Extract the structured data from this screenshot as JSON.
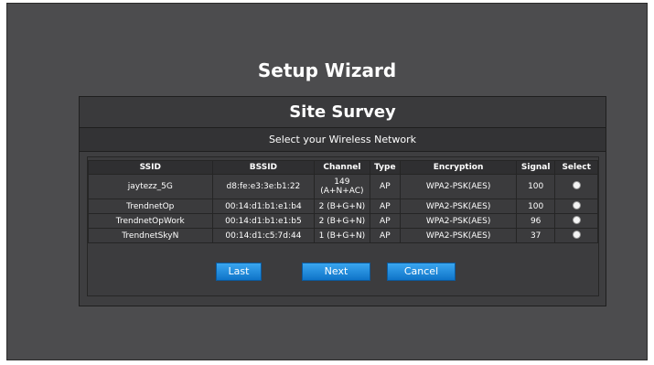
{
  "title": "Setup Wizard",
  "panel": {
    "header": "Site Survey",
    "subheader": "Select your Wireless Network"
  },
  "table": {
    "columns": [
      "SSID",
      "BSSID",
      "Channel",
      "Type",
      "Encryption",
      "Signal",
      "Select"
    ],
    "rows": [
      {
        "ssid": "jaytezz_5G",
        "bssid": "d8:fe:e3:3e:b1:22",
        "channel_line1": "149",
        "channel_line2": "(A+N+AC)",
        "type": "AP",
        "encryption": "WPA2-PSK(AES)",
        "signal": "100"
      },
      {
        "ssid": "TrendnetOp",
        "bssid": "00:14:d1:b1:e1:b4",
        "channel": "2 (B+G+N)",
        "type": "AP",
        "encryption": "WPA2-PSK(AES)",
        "signal": "100"
      },
      {
        "ssid": "TrendnetOpWork",
        "bssid": "00:14:d1:b1:e1:b5",
        "channel": "2 (B+G+N)",
        "type": "AP",
        "encryption": "WPA2-PSK(AES)",
        "signal": "96"
      },
      {
        "ssid": "TrendnetSkyN",
        "bssid": "00:14:d1:c5:7d:44",
        "channel": "1 (B+G+N)",
        "type": "AP",
        "encryption": "WPA2-PSK(AES)",
        "signal": "37"
      }
    ]
  },
  "buttons": {
    "last": "Last",
    "next": "Next",
    "cancel": "Cancel"
  },
  "colors": {
    "background": "#4c4c4e",
    "button": "#1a86dd"
  }
}
